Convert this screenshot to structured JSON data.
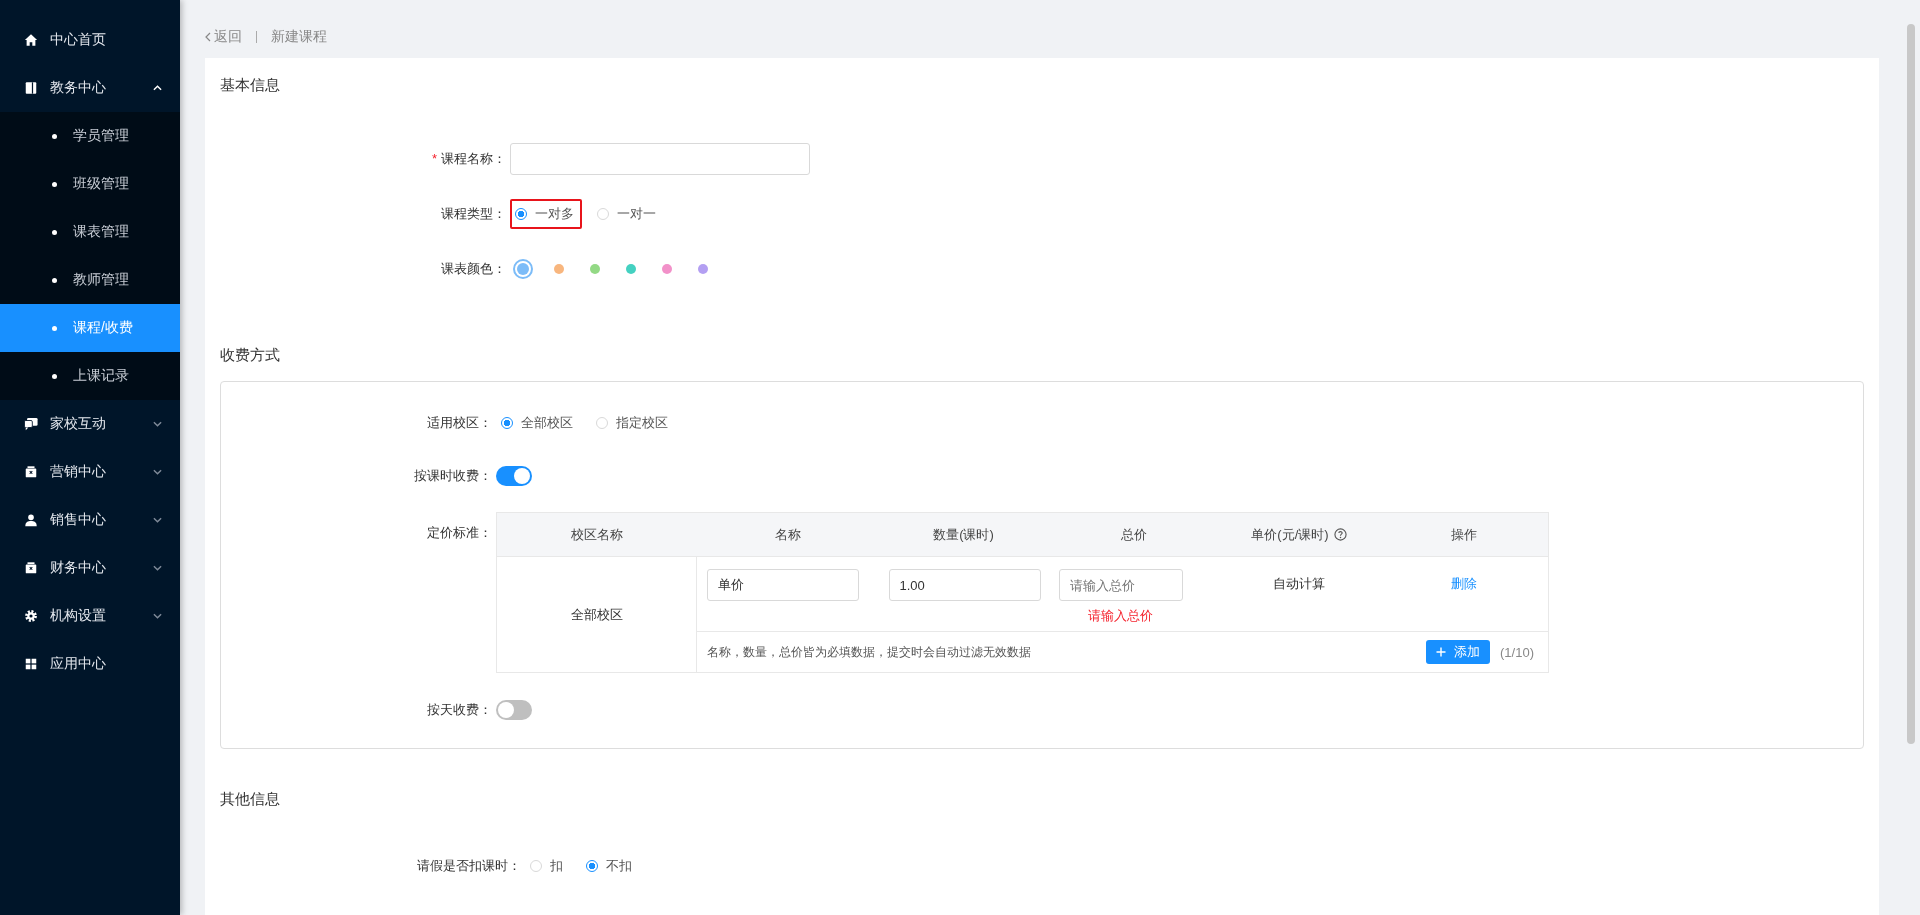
{
  "sidebar": {
    "items": [
      {
        "label": "中心首页",
        "selected": false
      },
      {
        "label": "教务中心",
        "selected": false,
        "expanded": true,
        "children": [
          {
            "label": "学员管理",
            "selected": false
          },
          {
            "label": "班级管理",
            "selected": false
          },
          {
            "label": "课表管理",
            "selected": false
          },
          {
            "label": "教师管理",
            "selected": false
          },
          {
            "label": "课程/收费",
            "selected": true
          },
          {
            "label": "上课记录",
            "selected": false
          }
        ]
      },
      {
        "label": "家校互动",
        "selected": false,
        "expanded": false
      },
      {
        "label": "营销中心",
        "selected": false,
        "expanded": false
      },
      {
        "label": "销售中心",
        "selected": false,
        "expanded": false
      },
      {
        "label": "财务中心",
        "selected": false,
        "expanded": false
      },
      {
        "label": "机构设置",
        "selected": false,
        "expanded": false
      },
      {
        "label": "应用中心",
        "selected": false
      }
    ]
  },
  "breadcrumb": {
    "back": "返回",
    "current": "新建课程"
  },
  "basic": {
    "title": "基本信息",
    "course_name": {
      "label": "课程名称：",
      "required_mark": "*"
    },
    "course_type": {
      "label": "课程类型：",
      "options": [
        {
          "label": "一对多",
          "selected": true,
          "highlighted": true
        },
        {
          "label": "一对一",
          "selected": false,
          "highlighted": false
        }
      ]
    },
    "schedule_color": {
      "label": "课表颜色：",
      "options": [
        {
          "color": "#7cbcf8",
          "selected": true
        },
        {
          "color": "#f8b67e",
          "selected": false
        },
        {
          "color": "#93d985",
          "selected": false
        },
        {
          "color": "#44d1c1",
          "selected": false
        },
        {
          "color": "#f291c9",
          "selected": false
        },
        {
          "color": "#b39ff2",
          "selected": false
        }
      ]
    }
  },
  "fee": {
    "title": "收费方式",
    "campus": {
      "label": "适用校区：",
      "options": [
        {
          "label": "全部校区",
          "selected": true
        },
        {
          "label": "指定校区",
          "selected": false
        }
      ]
    },
    "by_hour": {
      "label": "按课时收费：",
      "on": true
    },
    "pricing": {
      "label": "定价标准：",
      "columns": [
        {
          "label": "校区名称",
          "help": false
        },
        {
          "label": "名称",
          "help": false
        },
        {
          "label": "数量(课时)",
          "help": false
        },
        {
          "label": "总价",
          "help": false
        },
        {
          "label": "单价(元/课时)",
          "help": true
        },
        {
          "label": "操作",
          "help": false
        }
      ],
      "rows": [
        {
          "campus": "全部校区",
          "name": "单价",
          "quantity": "1.00",
          "total_placeholder": "请输入总价",
          "error": "请输入总价",
          "unit_price": "自动计算",
          "action": "删除"
        }
      ],
      "note": "名称，数量，总价皆为必填数据，提交时会自动过滤无效数据",
      "add_button": "添加",
      "count": "(1/10)"
    },
    "by_day": {
      "label": "按天收费：",
      "on": false
    }
  },
  "other": {
    "title": "其他信息",
    "leave": {
      "label": "请假是否扣课时：",
      "options": [
        {
          "label": "扣",
          "selected": false
        },
        {
          "label": "不扣",
          "selected": true
        }
      ]
    }
  }
}
